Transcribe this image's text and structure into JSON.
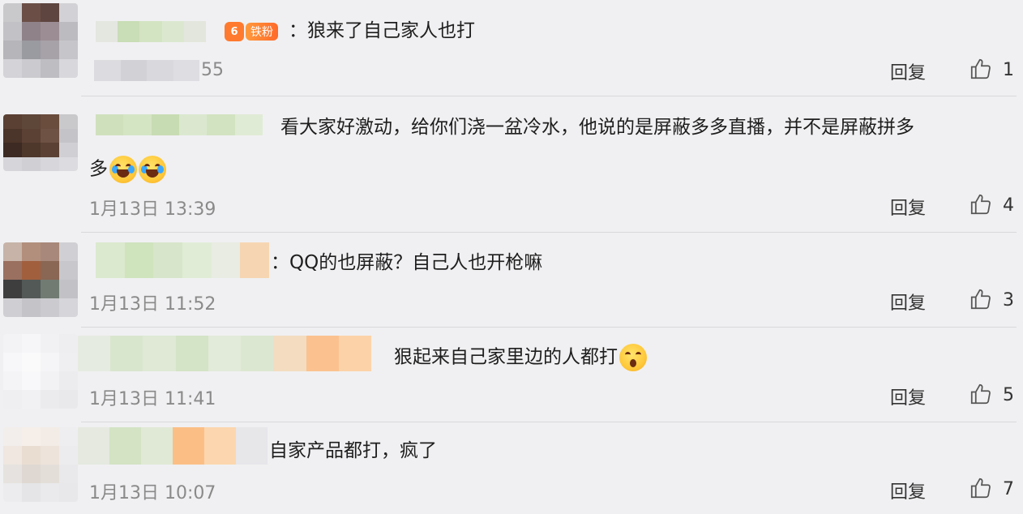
{
  "labels": {
    "reply": "回复"
  },
  "comments": [
    {
      "badge": {
        "icon": "6",
        "text": "铁粉"
      },
      "text": "：狼来了自己家人也打",
      "time": "55",
      "likes": "1"
    },
    {
      "text_line1": "看大家好激动，给你们浇一盆冷水，他说的是屏蔽多多直播，并不是屏蔽拼多",
      "text_line2": "多",
      "emojis": [
        "laugh-cry-emoji",
        "laugh-cry-emoji"
      ],
      "time": "1月13日 13:39",
      "likes": "4"
    },
    {
      "text": "：QQ的也屏蔽？自己人也开枪嘛",
      "time": "1月13日 11:52",
      "likes": "3"
    },
    {
      "text": "狠起来自己家里边的人都打",
      "emojis": [
        "shocked-emoji"
      ],
      "time": "1月13日 11:41",
      "likes": "5"
    },
    {
      "text": "自家产品都打，疯了",
      "time": "1月13日 10:07",
      "likes": "7"
    }
  ],
  "colors": {
    "background": "#f0f0f2",
    "badge": "#ff7a2e",
    "time": "#8a8a8a"
  }
}
